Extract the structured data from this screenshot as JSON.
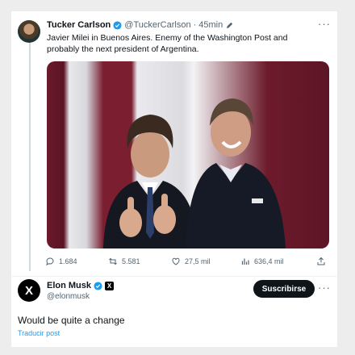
{
  "tweet": {
    "author_name": "Tucker Carlson",
    "author_handle": "@TuckerCarlson",
    "separator": "·",
    "time": "45min",
    "text": "Javier Milei in Buenos Aires. Enemy of the Washington Post and probably the next president of Argentina.",
    "more": "···",
    "actions": {
      "replies": "1.684",
      "retweets": "5.581",
      "likes": "27,5 mil",
      "views": "636,4 mil"
    }
  },
  "reply": {
    "author_name": "Elon Musk",
    "author_handle": "@elonmusk",
    "affiliate_badge": "X",
    "subscribe_label": "Suscribirse",
    "more": "···",
    "avatar_letter": "X",
    "text": "Would be quite a change",
    "translate_label": "Traducir post"
  },
  "colors": {
    "verified": "#1d9bf0",
    "link": "#1d9bf0",
    "secondary_text": "#536471"
  }
}
